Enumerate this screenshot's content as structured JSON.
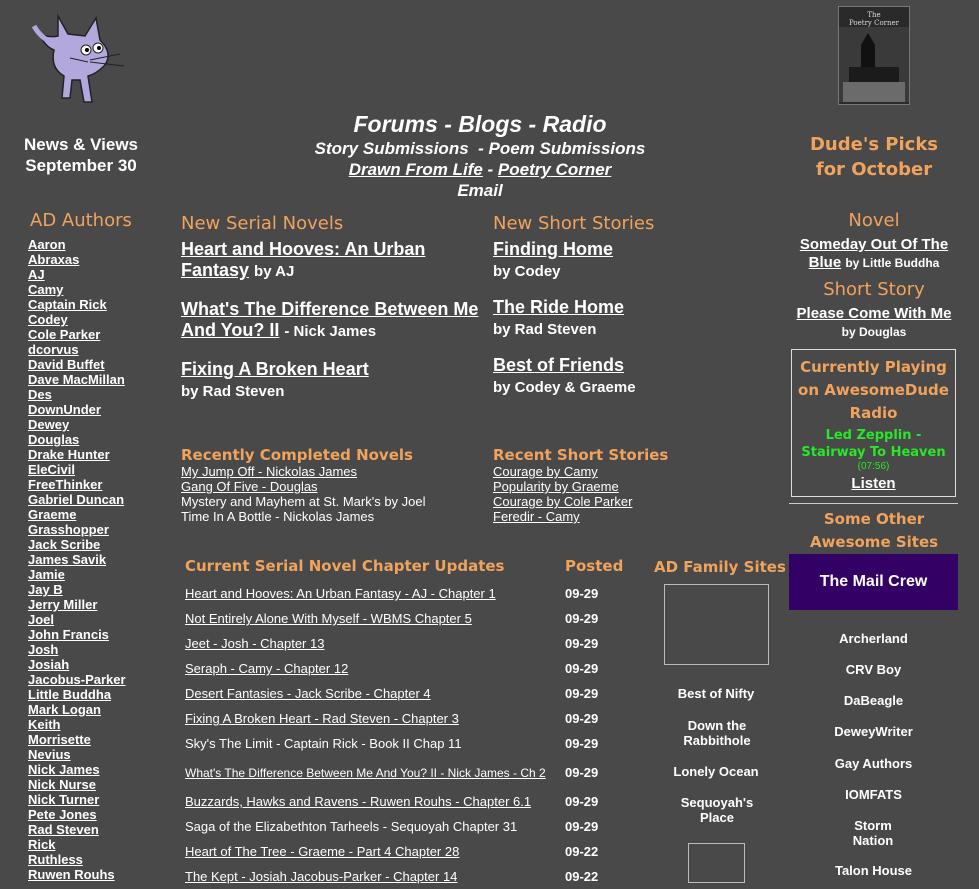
{
  "header": {
    "news_line1": "News & Views",
    "news_line2": "September 30",
    "nav_forums": "Forums",
    "nav_blogs": "Blogs",
    "nav_radio": "Radio",
    "nav_story_submissions": "Story Submissions",
    "nav_poem_submissions": "Poem Submissions",
    "nav_drawn": "Drawn From Life",
    "nav_poetry": "Poetry Corner",
    "nav_email": "Email",
    "sep": " - ",
    "book_title_line1": "The",
    "book_title_line2": "Poetry Corner",
    "dudes_picks_line1": "Dude's Picks",
    "dudes_picks_line2": "for October"
  },
  "authors": {
    "title": "AD Authors",
    "items": [
      "Aaron",
      "Abraxas",
      "AJ",
      "Camy",
      "Captain Rick",
      "Codey",
      "Cole Parker",
      "dcorvus",
      "David Buffet",
      "Dave MacMillan",
      "Des",
      "DownUnder",
      "Dewey",
      "Douglas",
      "Drake Hunter",
      "EleCivil",
      "FreeThinker",
      "Gabriel Duncan",
      "Graeme",
      "Grasshopper",
      "Jack Scribe",
      "James Savik",
      "Jamie",
      "Jay B",
      "Jerry Miller",
      "Joel",
      "John Francis",
      "Josh",
      "Josiah",
      "Jacobus-Parker",
      "Little Buddha",
      "Mark Logan",
      "Keith",
      "Morrisette",
      "Nevius",
      "Nick James",
      "Nick Nurse",
      "Nick Turner",
      "Pete Jones",
      "Rad Steven",
      "Rick",
      "Ruthless",
      "Ruwen Rouhs"
    ]
  },
  "serials": {
    "title": "New Serial Novels",
    "s1_title": "Heart and Hooves: An Urban Fantasy",
    "s1_by": "by AJ",
    "s2_title": "What's The Difference Between Me And You? II",
    "s2_by": "- Nick James",
    "s3_title": "Fixing A Broken Heart",
    "s3_by": "by Rad Steven"
  },
  "shorts": {
    "title": "New Short Stories",
    "s1_title": "Finding Home",
    "s1_by": "by Codey",
    "s2_title": "The Ride Home",
    "s2_by": "by Rad Steven",
    "s3_title": "Best of Friends",
    "s3_by": "by Codey & Graeme"
  },
  "completed": {
    "title": "Recently Completed Novels",
    "items": [
      "My Jump Off - Nickolas James",
      "Gang Of Five - Douglas",
      "Mystery and Mayhem at St. Mark's by Joel",
      "Time In A Bottle - Nickolas James"
    ]
  },
  "recent_shorts": {
    "title": "Recent Short Stories",
    "items": [
      "Courage by Camy",
      "Popularity by Graeme",
      "Courage by Cole Parker",
      "Feredir - Camy"
    ]
  },
  "updates": {
    "col_title": "Current Serial Novel Chapter Updates",
    "col_posted": "Posted",
    "rows": [
      {
        "title": "Heart and Hooves: An Urban Fantasy - AJ - Chapter 1",
        "date": "09-29"
      },
      {
        "title": "Not Entirely Alone With Myself - WBMS Chapter 5",
        "date": "09-29"
      },
      {
        "title": "Jeet - Josh - Chapter 13",
        "date": "09-29"
      },
      {
        "title": "Seraph - Camy - Chapter 12",
        "date": "09-29"
      },
      {
        "title": "Desert Fantasies - Jack Scribe - Chapter 4",
        "date": "09-29"
      },
      {
        "title": "Fixing A Broken Heart - Rad Steven - Chapter 3",
        "date": "09-29"
      },
      {
        "title": "Sky's The Limit - Captain Rick - Book II Chap 11",
        "date": "09-29"
      },
      {
        "title": "What's The Difference Between Me And You? II - Nick James - Ch 2",
        "date": "09-29"
      },
      {
        "title": "Buzzards, Hawks and Ravens - Ruwen Rouhs - Chapter 6.1",
        "date": "09-29"
      },
      {
        "title": "Saga of the Elizabethton Tarheels - Sequoyah Chapter 31",
        "date": "09-29"
      },
      {
        "title": "Heart of The Tree - Graeme - Part 4 Chapter 28",
        "date": "09-22"
      },
      {
        "title": "The Kept - Josiah Jacobus-Parker - Chapter 14",
        "date": "09-22"
      }
    ]
  },
  "family": {
    "title": "AD Family Sites",
    "items": [
      "Best of Nifty",
      "Down the Rabbithole",
      "Lonely Ocean",
      "Sequoyah's Place"
    ]
  },
  "picks": {
    "novel_head": "Novel",
    "novel_title": "Someday Out Of The Blue",
    "novel_by": "by Little Buddha",
    "short_head": "Short Story",
    "short_title": "Please Come With Me",
    "short_by": "by Douglas"
  },
  "radio": {
    "title_line1": "Currently Playing",
    "title_line2": "on AwesomeDude",
    "title_line3": "Radio",
    "song_line1": "Led Zepplin -",
    "song_line2": "Stairway To Heaven",
    "time": "(07:56)",
    "listen": "Listen"
  },
  "other_sites": {
    "title_line1": "Some Other",
    "title_line2": "Awesome Sites",
    "mailcrew": "The Mail Crew",
    "items": [
      "Archerland",
      "CRV Boy",
      "DaBeagle",
      "DeweyWriter",
      "Gay Authors",
      "IOMFATS",
      "Storm Nation",
      "Talon House"
    ]
  }
}
